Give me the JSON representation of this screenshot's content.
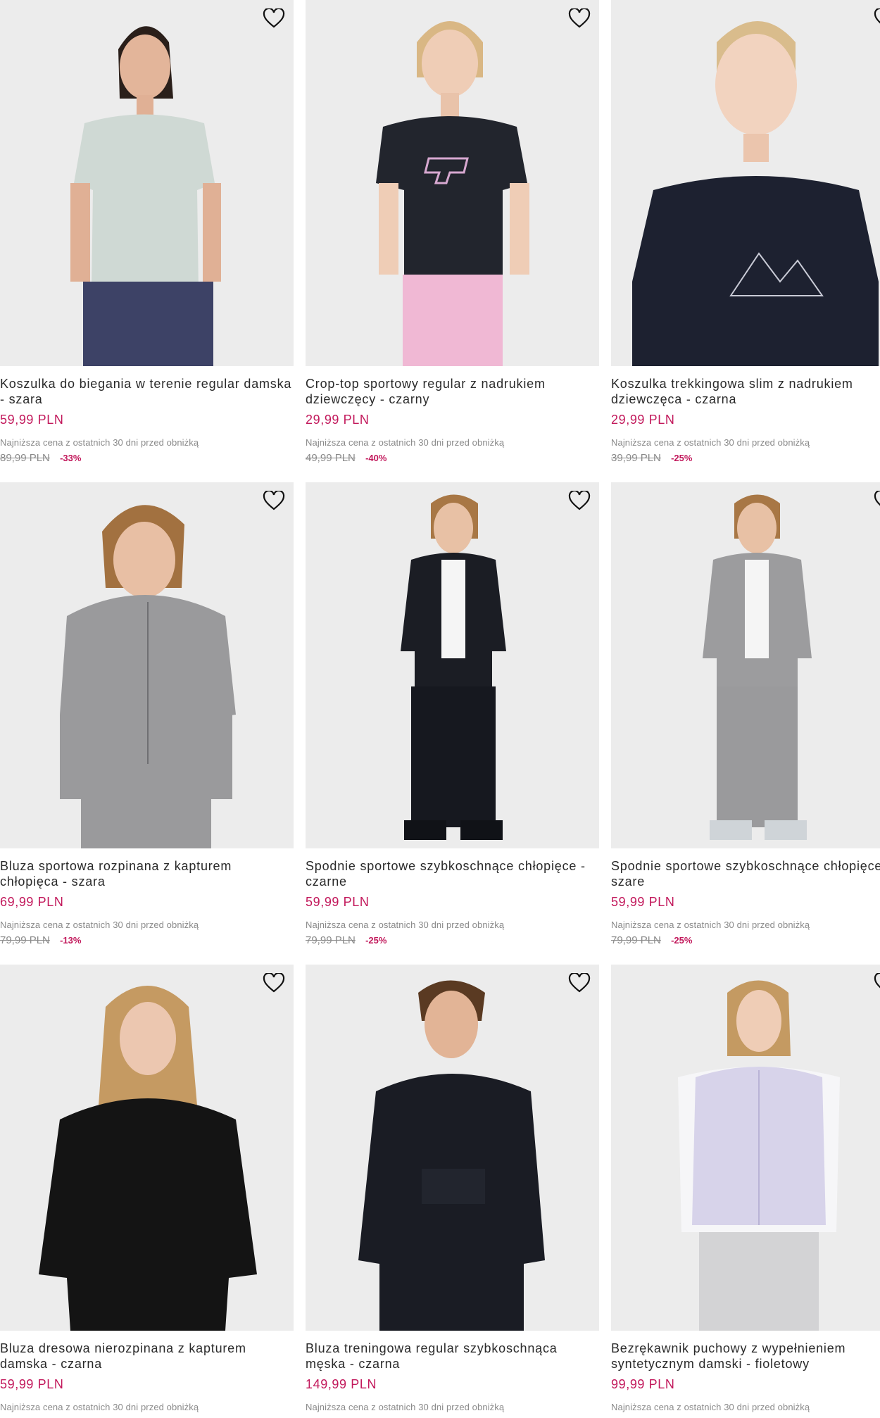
{
  "products": [
    {
      "name_line1": "Koszulka do biegania w terenie regular damska",
      "name_line2": "- szara",
      "price": "59,99 PLN",
      "lowest_note": "Najniższa cena z ostatnich 30 dni przed obniżką",
      "old_price": "89,99 PLN",
      "discount": "-33%",
      "image": "woman-light-grey-tshirt",
      "wishlist_icon": "heart-outline-icon"
    },
    {
      "name_line1": "Crop-top sportowy regular z nadrukiem",
      "name_line2": "dziewczęcy - czarny",
      "price": "29,99 PLN",
      "lowest_note": "Najniższa cena z ostatnich 30 dni przed obniżką",
      "old_price": "49,99 PLN",
      "discount": "-40%",
      "image": "girl-black-crop-top-4F-logo",
      "wishlist_icon": "heart-outline-icon"
    },
    {
      "name_line1": "Koszulka trekkingowa slim z nadrukiem",
      "name_line2": "dziewczęca - czarna",
      "price": "29,99 PLN",
      "lowest_note": "Najniższa cena z ostatnich 30 dni przed obniżką",
      "old_price": "39,99 PLN",
      "discount": "-25%",
      "image": "girl-black-tshirt-mountains-print",
      "wishlist_icon": "heart-outline-icon"
    },
    {
      "name_line1": "Bluza sportowa rozpinana z kapturem",
      "name_line2": "chłopięca - szara",
      "price": "69,99 PLN",
      "lowest_note": "Najniższa cena z ostatnich 30 dni przed obniżką",
      "old_price": "79,99 PLN",
      "discount": "-13%",
      "image": "boy-grey-zip-hoodie",
      "wishlist_icon": "heart-outline-icon"
    },
    {
      "name_line1": "Spodnie sportowe szybkoschnące chłopięce -",
      "name_line2": "czarne",
      "price": "59,99 PLN",
      "lowest_note": "Najniższa cena z ostatnich 30 dni przed obniżką",
      "old_price": "79,99 PLN",
      "discount": "-25%",
      "image": "boy-black-tracksuit",
      "wishlist_icon": "heart-outline-icon"
    },
    {
      "name_line1": "Spodnie sportowe szybkoschnące chłopięce -",
      "name_line2": "szare",
      "price": "59,99 PLN",
      "lowest_note": "Najniższa cena z ostatnich 30 dni przed obniżką",
      "old_price": "79,99 PLN",
      "discount": "-25%",
      "image": "boy-grey-tracksuit",
      "wishlist_icon": "heart-outline-icon"
    },
    {
      "name_line1": "Bluza dresowa nierozpinana z kapturem",
      "name_line2": "damska - czarna",
      "price": "59,99 PLN",
      "lowest_note": "Najniższa cena z ostatnich 30 dni przed obniżką",
      "old_price": "",
      "discount": "",
      "image": "woman-black-hoodie",
      "wishlist_icon": "heart-outline-icon"
    },
    {
      "name_line1": "Bluza treningowa regular szybkoschnąca",
      "name_line2": "męska - czarna",
      "price": "149,99 PLN",
      "lowest_note": "Najniższa cena z ostatnich 30 dni przed obniżką",
      "old_price": "",
      "discount": "",
      "image": "man-black-half-zip-hoodie",
      "wishlist_icon": "heart-outline-icon"
    },
    {
      "name_line1": "Bezrękawnik puchowy z wypełnieniem",
      "name_line2": "syntetycznym damski - fioletowy",
      "price": "99,99 PLN",
      "lowest_note": "Najniższa cena z ostatnich 30 dni przed obniżką",
      "old_price": "",
      "discount": "",
      "image": "woman-lilac-puffer-vest",
      "wishlist_icon": "heart-outline-icon"
    }
  ],
  "colors": {
    "price": "#c2185b",
    "muted": "#8a8a8a",
    "photo_bg": "#eeeeee"
  }
}
